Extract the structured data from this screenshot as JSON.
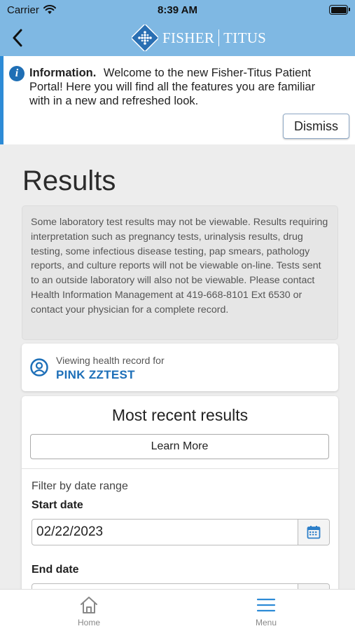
{
  "status_bar": {
    "carrier": "Carrier",
    "time": "8:39 AM"
  },
  "header": {
    "logo": {
      "left_word": "FISHER",
      "right_word": "TITUS"
    },
    "back_icon": "chevron-left-icon"
  },
  "info_banner": {
    "title": "Information.",
    "message": "Welcome to the new Fisher-Titus Patient Portal! Here you will find all the features you are familiar with in a new and refreshed look.",
    "dismiss_label": "Dismiss"
  },
  "page": {
    "title": "Results",
    "notice": "Some laboratory test results may not be viewable. Results requiring interpretation such as pregnancy tests, urinalysis results, drug testing, some infectious disease testing, pap smears, pathology reports, and culture reports will not be viewable on-line. Tests sent to an outside laboratory will also not be viewable. Please contact Health Information Management at 419-668-8101 Ext 6530 or contact your physician for a complete record."
  },
  "viewing": {
    "label": "Viewing health record for",
    "patient_name": "PINK ZZTEST"
  },
  "results": {
    "title": "Most recent results",
    "learn_more_label": "Learn More",
    "filter_label": "Filter by date range",
    "start_label": "Start date",
    "start_value": "02/22/2023",
    "end_label": "End date",
    "end_value": ""
  },
  "tabbar": {
    "home_label": "Home",
    "menu_label": "Menu"
  },
  "colors": {
    "header_bg": "#7fb8e3",
    "accent_blue": "#1d6fb8",
    "calendar_blue": "#2d7fc9"
  }
}
